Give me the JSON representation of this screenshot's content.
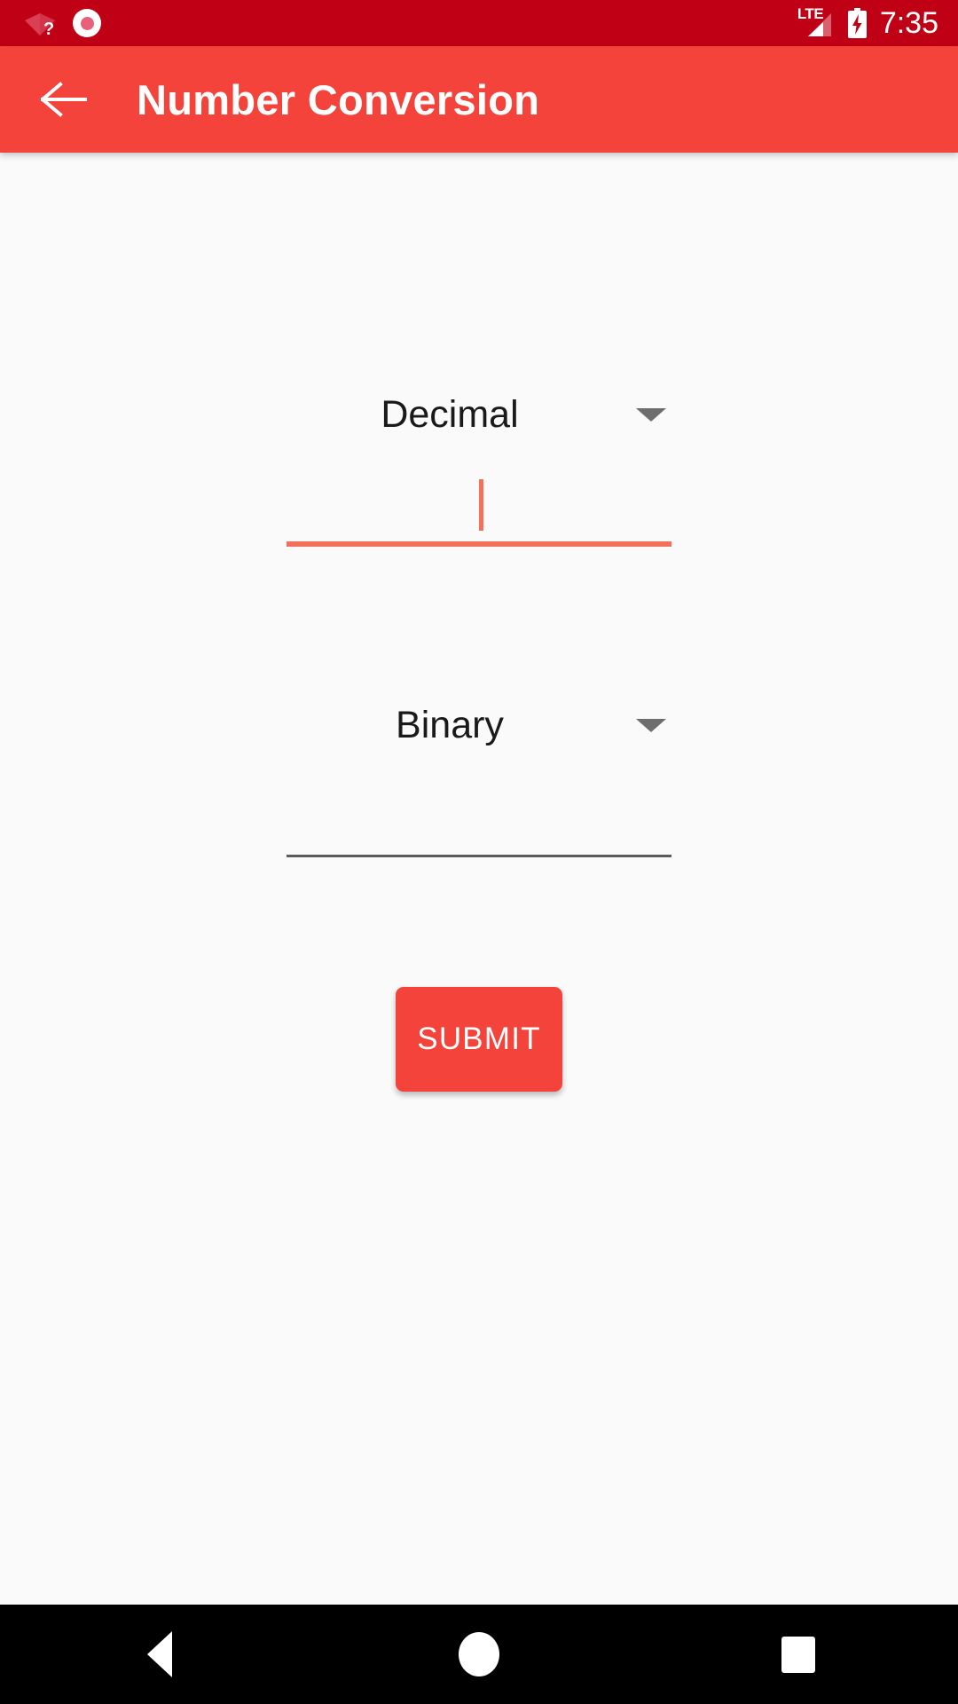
{
  "status_bar": {
    "background_color": "#C00014",
    "time": "7:35",
    "icons": {
      "wifi": "wifi-no-connection-icon",
      "recording": "screen-record-icon",
      "signal": "signal-lte-icon",
      "signal_label": "LTE",
      "battery": "battery-charging-icon"
    }
  },
  "app_bar": {
    "background_color": "#F4433A",
    "title": "Number Conversion",
    "back_label": "Navigate up"
  },
  "content": {
    "background_color": "#FAFAFA",
    "source": {
      "spinner_value": "Decimal",
      "input_value": "",
      "input_focused": true,
      "underline_color": "#F4705A"
    },
    "target": {
      "spinner_value": "Binary",
      "input_value": "",
      "input_focused": false,
      "underline_color": "#5B5B5B"
    },
    "submit": {
      "label": "SUBMIT",
      "color": "#F4433A"
    }
  },
  "nav_bar": {
    "background_color": "#000000",
    "back": "Back",
    "home": "Home",
    "recents": "Recent apps"
  }
}
